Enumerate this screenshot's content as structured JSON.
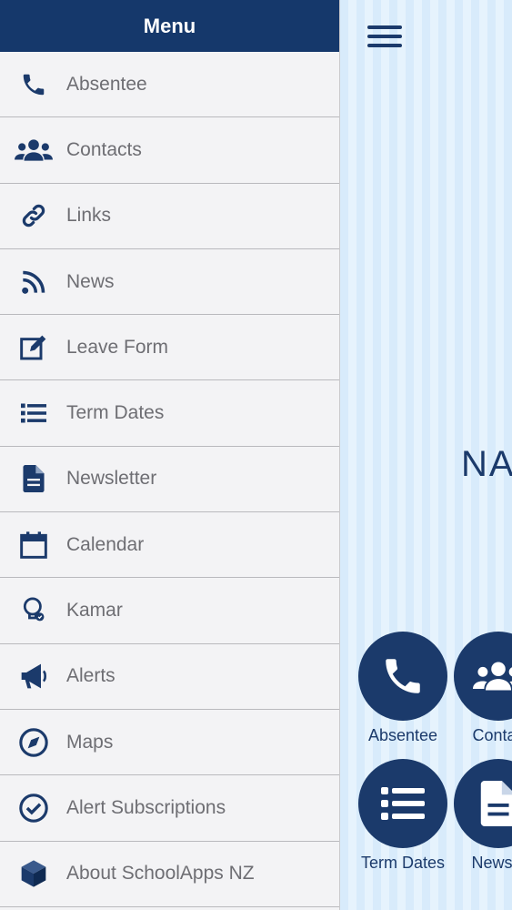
{
  "drawer": {
    "title": "Menu",
    "items": [
      {
        "label": "Absentee",
        "icon": "phone-icon"
      },
      {
        "label": "Contacts",
        "icon": "users-icon"
      },
      {
        "label": "Links",
        "icon": "link-icon"
      },
      {
        "label": "News",
        "icon": "rss-icon"
      },
      {
        "label": "Leave Form",
        "icon": "edit-icon"
      },
      {
        "label": "Term Dates",
        "icon": "list-icon"
      },
      {
        "label": "Newsletter",
        "icon": "document-icon"
      },
      {
        "label": "Calendar",
        "icon": "calendar-icon"
      },
      {
        "label": "Kamar",
        "icon": "lightbulb-icon"
      },
      {
        "label": "Alerts",
        "icon": "megaphone-icon"
      },
      {
        "label": "Maps",
        "icon": "compass-icon"
      },
      {
        "label": "Alert Subscriptions",
        "icon": "check-circle-icon"
      },
      {
        "label": "About SchoolApps NZ",
        "icon": "cube-icon"
      }
    ]
  },
  "app": {
    "school_name": "NA",
    "tiles": [
      {
        "label": "Absentee",
        "icon": "phone-icon"
      },
      {
        "label": "Contac",
        "icon": "users-icon"
      },
      {
        "label": "Term Dates",
        "icon": "list-icon"
      },
      {
        "label": "Newsle",
        "icon": "document-icon"
      }
    ]
  },
  "colors": {
    "navy": "#15386b",
    "icon": "#1b3a6b",
    "drawer_bg": "#f3f3f5",
    "label_gray": "#6e6e73",
    "stripe_light": "#e6f3fd",
    "stripe_dark": "#d8ebfb"
  }
}
